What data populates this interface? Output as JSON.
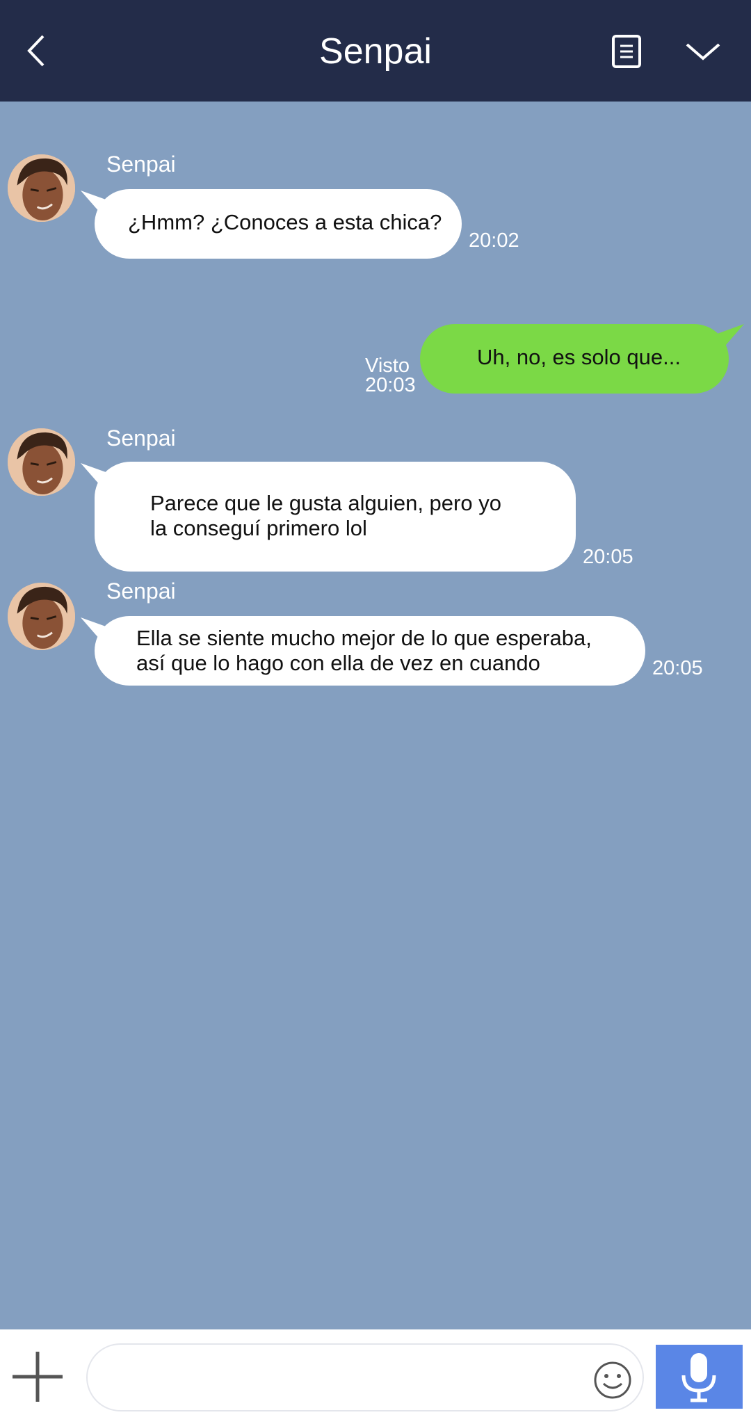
{
  "header": {
    "title": "Senpai",
    "back_icon": "chevron-left-icon",
    "notes_icon": "notes-icon",
    "menu_icon": "chevron-down-icon",
    "background": "#232c49"
  },
  "chat": {
    "background": "#849fc0",
    "messages": [
      {
        "side": "left",
        "sender": "Senpai",
        "text": "¿Hmm? ¿Conoces a esta chica?",
        "time": "20:02"
      },
      {
        "side": "right",
        "text": "Uh, no, es solo que...",
        "status": "Visto",
        "time": "20:03"
      },
      {
        "side": "left",
        "sender": "Senpai",
        "line1": "Parece que le gusta alguien, pero yo",
        "line2": "la conseguí primero lol",
        "time": "20:05"
      },
      {
        "side": "left",
        "sender": "Senpai",
        "line1": "Ella se siente mucho mejor de lo que esperaba,",
        "line2": "así que lo hago con ella de vez en cuando",
        "time": "20:05"
      }
    ]
  },
  "footer": {
    "plus_icon": "plus-icon",
    "input_value": "",
    "emoji_icon": "smiley-icon",
    "mic_icon": "microphone-icon",
    "mic_color": "#5a86e6"
  }
}
